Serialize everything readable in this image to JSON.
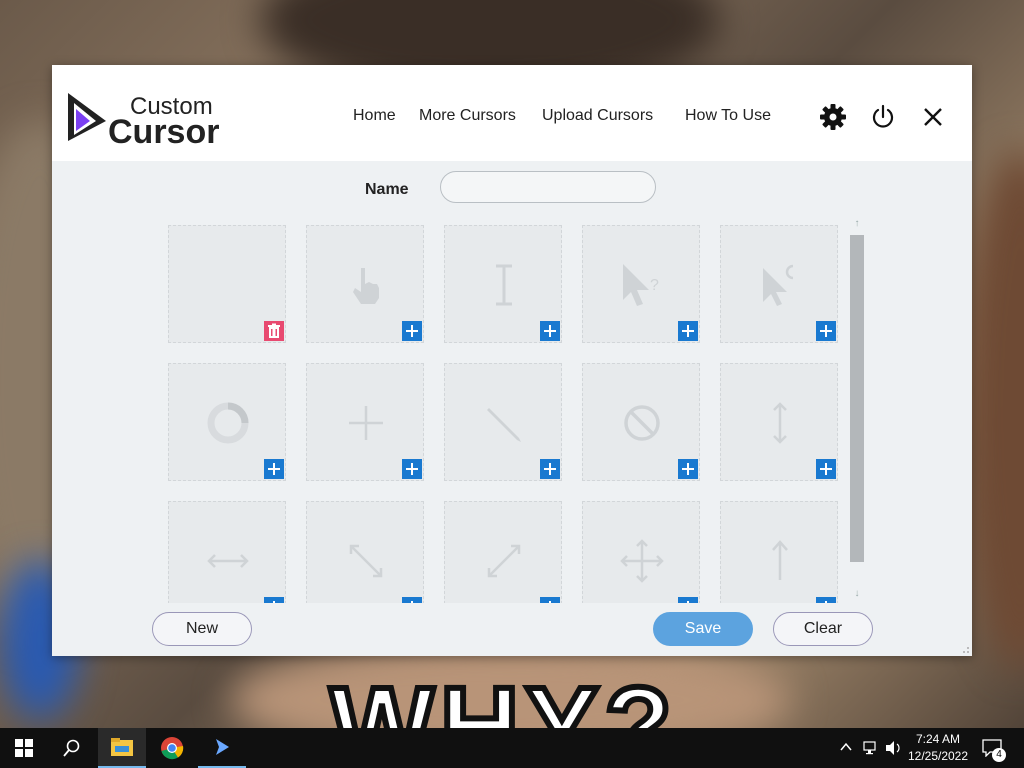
{
  "app": {
    "logo_top": "Custom",
    "logo_bottom": "Cursor",
    "nav": [
      "Home",
      "More Cursors",
      "Upload Cursors",
      "How To Use"
    ],
    "header_icons": [
      "gear-icon",
      "power-icon",
      "close-icon"
    ]
  },
  "form": {
    "name_label": "Name",
    "name_value": "",
    "name_placeholder": ""
  },
  "cursor_slots": [
    {
      "icon": "empty",
      "action": "delete"
    },
    {
      "icon": "hand-pointer-icon",
      "action": "add"
    },
    {
      "icon": "text-beam-icon",
      "action": "add"
    },
    {
      "icon": "help-cursor-icon",
      "action": "add"
    },
    {
      "icon": "working-cursor-icon",
      "action": "add"
    },
    {
      "icon": "busy-ring-icon",
      "action": "add"
    },
    {
      "icon": "crosshair-icon",
      "action": "add"
    },
    {
      "icon": "pen-icon",
      "action": "add"
    },
    {
      "icon": "unavailable-icon",
      "action": "add"
    },
    {
      "icon": "vertical-resize-icon",
      "action": "add"
    },
    {
      "icon": "horizontal-resize-icon",
      "action": "add"
    },
    {
      "icon": "diagonal-resize-1-icon",
      "action": "add"
    },
    {
      "icon": "diagonal-resize-2-icon",
      "action": "add"
    },
    {
      "icon": "move-icon",
      "action": "add"
    },
    {
      "icon": "alternate-select-icon",
      "action": "add"
    }
  ],
  "buttons": {
    "new": "New",
    "save": "Save",
    "clear": "Clear"
  },
  "taskbar": {
    "time": "7:24 AM",
    "date": "12/25/2022",
    "notification_count": "4",
    "apps": [
      "file-explorer-icon",
      "chrome-icon",
      "custom-cursor-app-icon"
    ]
  },
  "wallpaper_text": "WHY?",
  "colors": {
    "accent": "#1979d0",
    "delete": "#e84a70",
    "save": "#5ca3df"
  }
}
